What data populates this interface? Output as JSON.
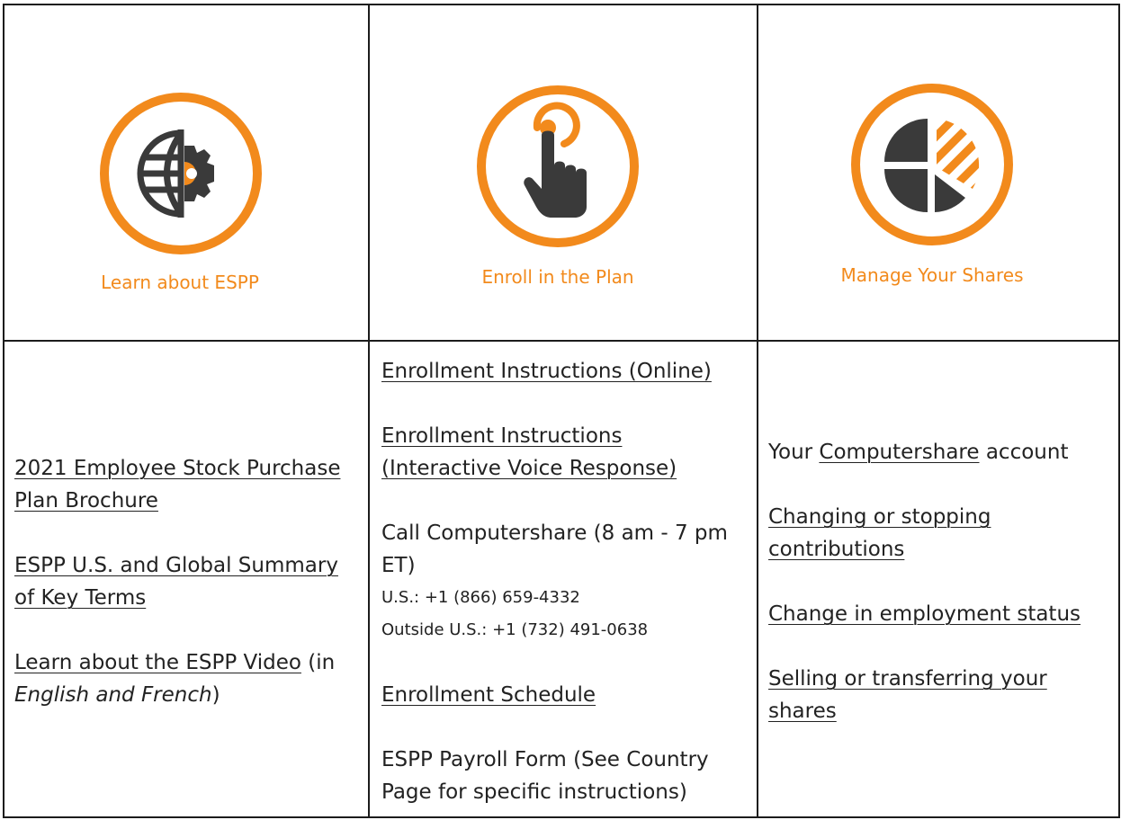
{
  "colors": {
    "accent": "#f28a1c",
    "icon_dark": "#3a3a3a",
    "border": "#1c1c1c"
  },
  "header": {
    "col1": {
      "icon": "globe-gear-icon",
      "caption": "Learn about ESPP"
    },
    "col2": {
      "icon": "pointing-hand-icon",
      "caption": "Enroll in the Plan"
    },
    "col3": {
      "icon": "pie-chart-icon",
      "caption": "Manage Your Shares"
    }
  },
  "learn": {
    "brochure_link": "2021 Employee Stock Purchase Plan Brochure",
    "brochure_line1": "2021 Employee Stock Purchase",
    "brochure_line2": "Plan Brochure",
    "summary_line1": "ESPP U.S. and Global Summary",
    "summary_line2": "of Key Terms",
    "video_link": "Learn about the ESPP Video",
    "video_suffix": " (in",
    "video_lang": "English and French",
    "video_close": ")"
  },
  "enroll": {
    "online_link": "Enrollment Instructions (Online)",
    "ivr_line1": "Enrollment Instructions",
    "ivr_line2": "(Interactive Voice Response)",
    "call_line1": "Call Computershare (8 am - 7 pm",
    "call_line2": "ET)",
    "us_phone": "U.S.: +1 (866) 659-4332",
    "outside_phone": "Outside U.S.: +1 (732) 491-0638",
    "schedule_link": "Enrollment Schedule",
    "payroll_line1": "ESPP Payroll Form (See Country",
    "payroll_line2": "Page for specific instructions)"
  },
  "manage": {
    "your_prefix": "Your ",
    "computershare_link": "Computershare",
    "account_suffix": " account",
    "changing_line1": "Changing or stopping",
    "changing_line2": "contributions",
    "employment_link": "Change in employment status",
    "selling_line1": "Selling or transferring your",
    "selling_line2": "shares"
  }
}
